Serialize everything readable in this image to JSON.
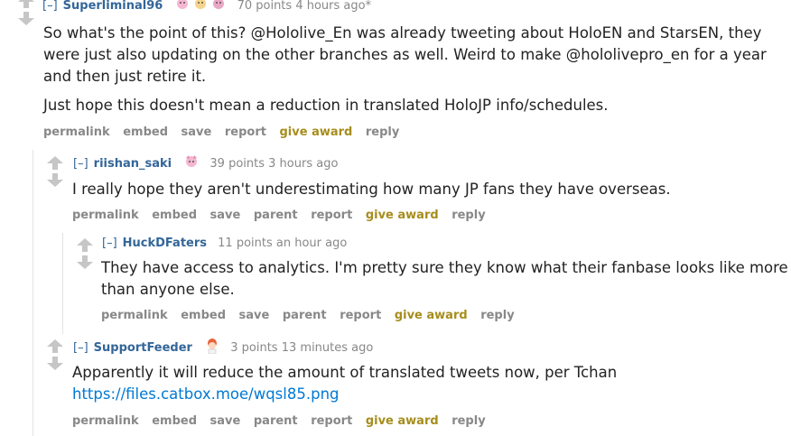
{
  "comments": [
    {
      "author": "Superliminal96",
      "collapse": "[–]",
      "score": "70 points",
      "time": "4 hours ago*",
      "paragraphs": [
        "So what's the point of this? @Hololive_En was already tweeting about HoloEN and StarsEN, they were just also updating on the other branches as well. Weird to make @hololivepro_en for a year and then just retire it.",
        "Just hope this doesn't mean a reduction in translated HoloJP info/schedules."
      ],
      "buttons": [
        "permalink",
        "embed",
        "save",
        "report",
        "give award",
        "reply"
      ]
    },
    {
      "author": "riishan_saki",
      "collapse": "[–]",
      "score": "39 points",
      "time": "3 hours ago",
      "paragraphs": [
        "I really hope they aren't underestimating how many JP fans they have overseas."
      ],
      "buttons": [
        "permalink",
        "embed",
        "save",
        "parent",
        "report",
        "give award",
        "reply"
      ]
    },
    {
      "author": "HuckDFaters",
      "collapse": "[–]",
      "score": "11 points",
      "time": "an hour ago",
      "paragraphs": [
        "They have access to analytics. I'm pretty sure they know what their fanbase looks like more than anyone else."
      ],
      "buttons": [
        "permalink",
        "embed",
        "save",
        "parent",
        "report",
        "give award",
        "reply"
      ]
    },
    {
      "author": "SupportFeeder",
      "collapse": "[–]",
      "score": "3 points",
      "time": "13 minutes ago",
      "paragraphs": [
        "Apparently it will reduce the amount of translated tweets now, per Tchan"
      ],
      "link": "https://files.catbox.moe/wqsl85.png",
      "buttons": [
        "permalink",
        "embed",
        "save",
        "parent",
        "report",
        "give award",
        "reply"
      ]
    }
  ],
  "colors": {
    "author": "#336699",
    "award": "#a68d1d",
    "meta": "#888888",
    "link": "#0079d3"
  }
}
